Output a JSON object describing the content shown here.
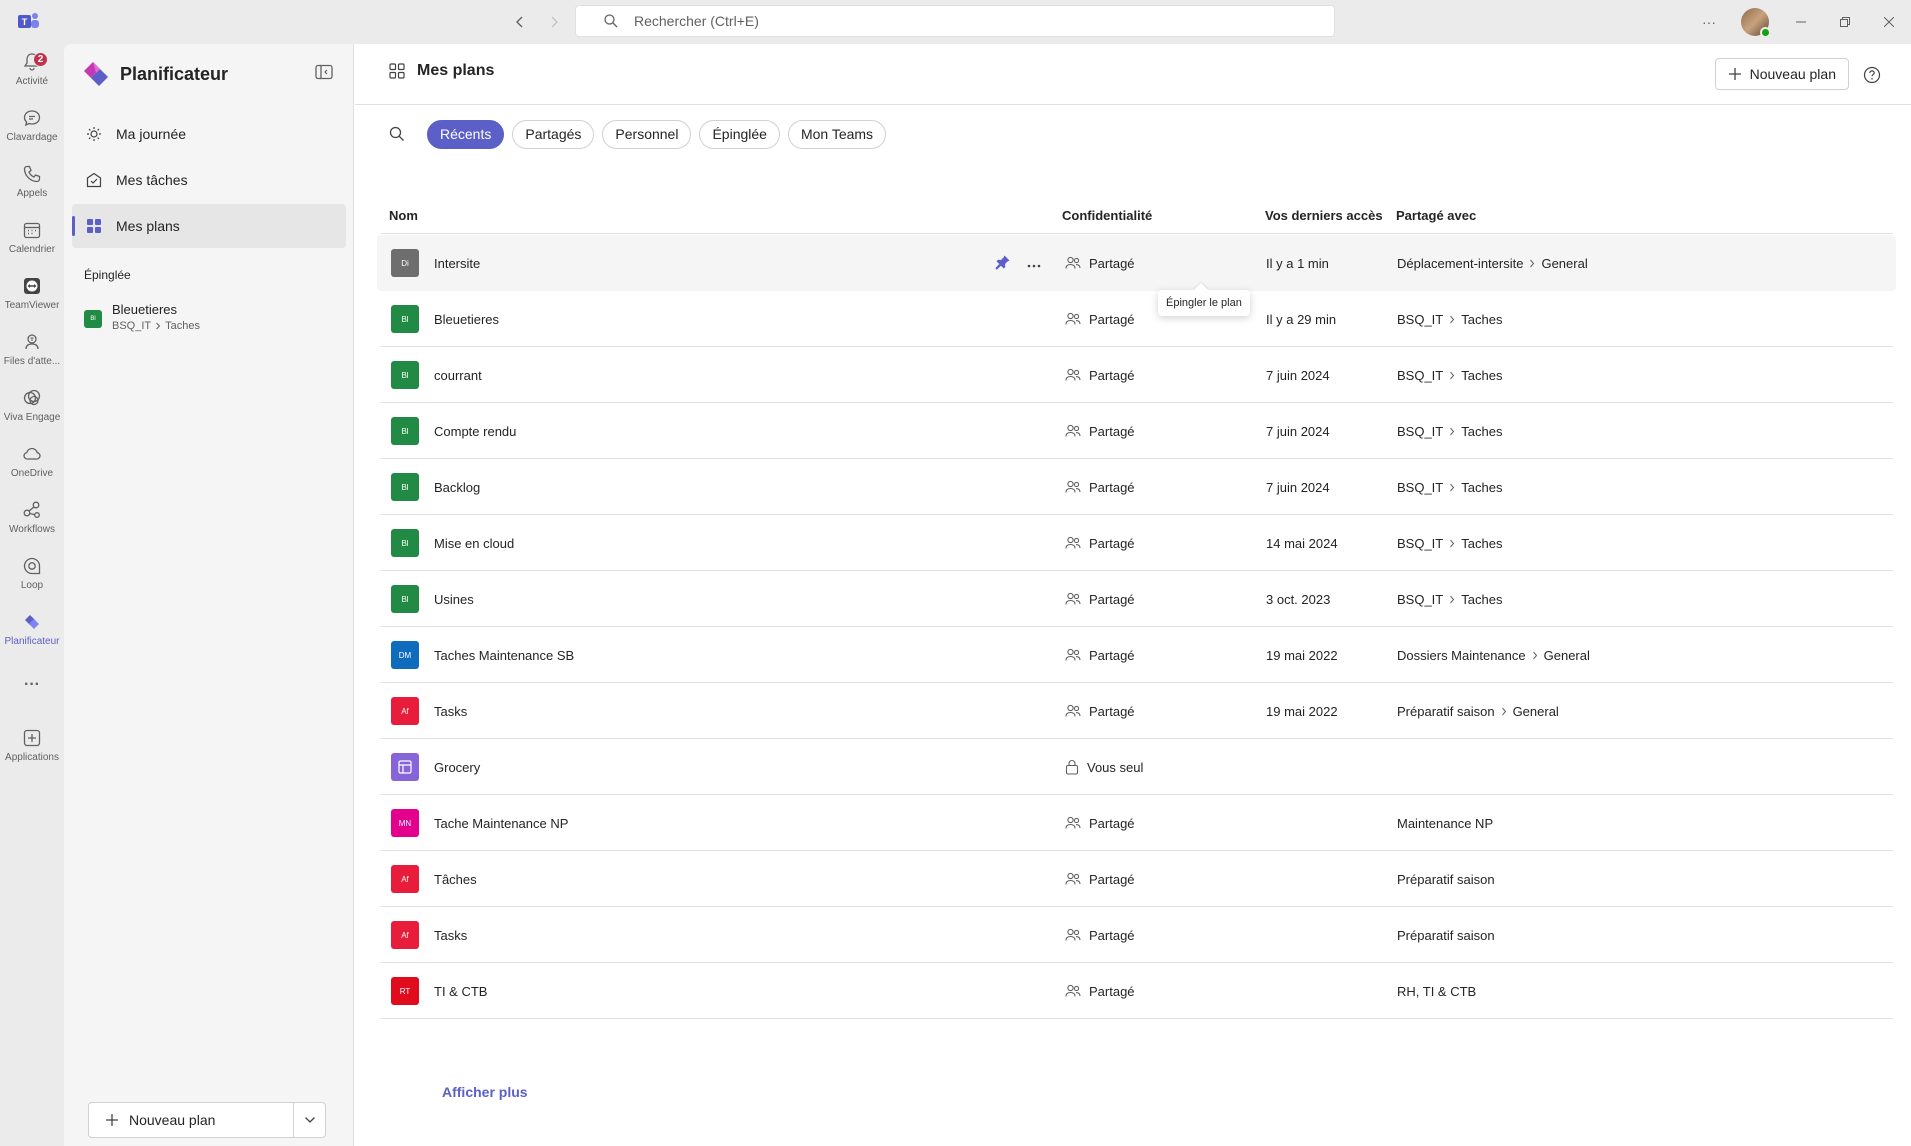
{
  "titlebar": {
    "search_placeholder": "Rechercher (Ctrl+E)",
    "more": "···"
  },
  "rail": [
    {
      "label": "Activité",
      "icon": "bell-icon",
      "badge": "2"
    },
    {
      "label": "Clavardage",
      "icon": "chat-icon"
    },
    {
      "label": "Appels",
      "icon": "phone-icon"
    },
    {
      "label": "Calendrier",
      "icon": "calendar-icon"
    },
    {
      "label": "TeamViewer",
      "icon": "teamviewer-icon"
    },
    {
      "label": "Files d'atte...",
      "icon": "queue-icon"
    },
    {
      "label": "Viva Engage",
      "icon": "viva-engage-icon"
    },
    {
      "label": "OneDrive",
      "icon": "cloud-icon"
    },
    {
      "label": "Workflows",
      "icon": "workflows-icon"
    },
    {
      "label": "Loop",
      "icon": "loop-icon"
    },
    {
      "label": "Planificateur",
      "icon": "planner-icon"
    },
    {
      "label": "Applications",
      "icon": "add-app-icon"
    }
  ],
  "rail_more": "···",
  "leftpane": {
    "title": "Planificateur",
    "nav": [
      {
        "label": "Ma journée",
        "icon": "sun-icon"
      },
      {
        "label": "Mes tâches",
        "icon": "tasks-icon"
      },
      {
        "label": "Mes plans",
        "icon": "grid-icon"
      }
    ],
    "section": "Épinglée",
    "pinned": {
      "initials": "Bl",
      "name": "Bleuetieres",
      "team": "BSQ_IT",
      "channel": "Taches"
    },
    "new_plan": "Nouveau plan"
  },
  "content": {
    "title": "Mes plans",
    "new_plan": "Nouveau plan",
    "filters": [
      "Récents",
      "Partagés",
      "Personnel",
      "Épinglée",
      "Mon Teams"
    ],
    "columns": {
      "name": "Nom",
      "privacy": "Confidentialité",
      "last": "Vos derniers accès",
      "shared": "Partagé avec"
    },
    "tooltip": "Épingler le plan",
    "show_more": "Afficher plus",
    "rows": [
      {
        "initials": "Di",
        "color": "#6e6e6e",
        "name": "Intersite",
        "privacy": "Partagé",
        "private": false,
        "last": "Il y a 1 min",
        "team": "Déplacement-intersite",
        "channel": "General"
      },
      {
        "initials": "Bl",
        "color": "#218a45",
        "name": "Bleuetieres",
        "privacy": "Partagé",
        "private": false,
        "last": "Il y a 29 min",
        "team": "BSQ_IT",
        "channel": "Taches"
      },
      {
        "initials": "Bl",
        "color": "#218a45",
        "name": "courrant",
        "privacy": "Partagé",
        "private": false,
        "last": "7 juin 2024",
        "team": "BSQ_IT",
        "channel": "Taches"
      },
      {
        "initials": "Bl",
        "color": "#218a45",
        "name": "Compte rendu",
        "privacy": "Partagé",
        "private": false,
        "last": "7 juin 2024",
        "team": "BSQ_IT",
        "channel": "Taches"
      },
      {
        "initials": "Bl",
        "color": "#218a45",
        "name": "Backlog",
        "privacy": "Partagé",
        "private": false,
        "last": "7 juin 2024",
        "team": "BSQ_IT",
        "channel": "Taches"
      },
      {
        "initials": "Bl",
        "color": "#218a45",
        "name": "Mise en cloud",
        "privacy": "Partagé",
        "private": false,
        "last": "14 mai 2024",
        "team": "BSQ_IT",
        "channel": "Taches"
      },
      {
        "initials": "Bl",
        "color": "#218a45",
        "name": "Usines",
        "privacy": "Partagé",
        "private": false,
        "last": "3 oct. 2023",
        "team": "BSQ_IT",
        "channel": "Taches"
      },
      {
        "initials": "DM",
        "color": "#0f6cbd",
        "name": "Taches Maintenance SB",
        "privacy": "Partagé",
        "private": false,
        "last": "19 mai 2022",
        "team": "Dossiers Maintenance",
        "channel": "General"
      },
      {
        "initials": "Af",
        "color": "#e81c3b",
        "name": "Tasks",
        "privacy": "Partagé",
        "private": false,
        "last": "19 mai 2022",
        "team": "Préparatif saison",
        "channel": "General"
      },
      {
        "initials": "",
        "color": "#8764d8",
        "name": "Grocery",
        "privacy": "Vous seul",
        "private": true,
        "last": "",
        "team": "",
        "channel": ""
      },
      {
        "initials": "MN",
        "color": "#e3008c",
        "name": "Tache Maintenance NP",
        "privacy": "Partagé",
        "private": false,
        "last": "",
        "team": "Maintenance NP",
        "channel": ""
      },
      {
        "initials": "Af",
        "color": "#e81c3b",
        "name": "Tâches",
        "privacy": "Partagé",
        "private": false,
        "last": "",
        "team": "Préparatif saison",
        "channel": ""
      },
      {
        "initials": "Af",
        "color": "#e81c3b",
        "name": "Tasks",
        "privacy": "Partagé",
        "private": false,
        "last": "",
        "team": "Préparatif saison",
        "channel": ""
      },
      {
        "initials": "RT",
        "color": "#e00b1c",
        "name": "TI & CTB",
        "privacy": "Partagé",
        "private": false,
        "last": "",
        "team": "RH, TI & CTB",
        "channel": ""
      }
    ]
  }
}
